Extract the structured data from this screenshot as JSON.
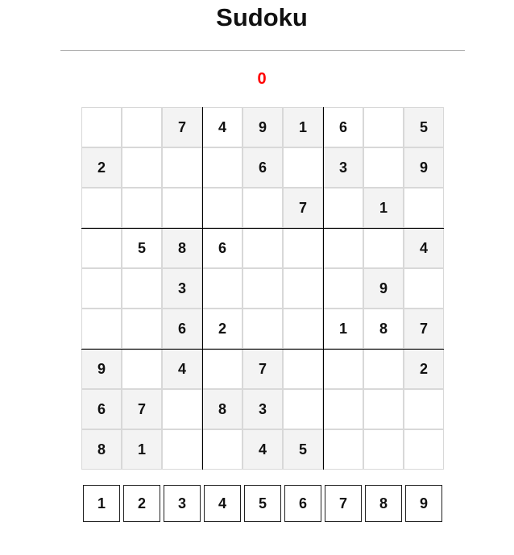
{
  "title": "Sudoku",
  "score": "0",
  "colors": {
    "score": "#ff0000",
    "given_cell_bg": "#f3f3f3",
    "empty_cell_bg": "#ffffff",
    "cell_border": "#d8d8d8",
    "box_border": "#000000"
  },
  "grid": [
    [
      "",
      "",
      "7",
      "4",
      "9",
      "1",
      "6",
      "",
      "5"
    ],
    [
      "2",
      "",
      "",
      "",
      "6",
      "",
      "3",
      "",
      "9"
    ],
    [
      "",
      "",
      "",
      "",
      "",
      "7",
      "",
      "1",
      ""
    ],
    [
      "",
      "5",
      "8",
      "6",
      "",
      "",
      "",
      "",
      "4"
    ],
    [
      "",
      "",
      "3",
      "",
      "",
      "",
      "",
      "9",
      ""
    ],
    [
      "",
      "",
      "6",
      "2",
      "",
      "",
      "1",
      "8",
      "7"
    ],
    [
      "9",
      "",
      "4",
      "",
      "7",
      "",
      "",
      "",
      "2"
    ],
    [
      "6",
      "7",
      "",
      "8",
      "3",
      "",
      "",
      "",
      ""
    ],
    [
      "8",
      "1",
      "",
      "",
      "4",
      "5",
      "",
      "",
      ""
    ]
  ],
  "shaded": [
    [
      0,
      0,
      1,
      0,
      1,
      1,
      0,
      0,
      1
    ],
    [
      1,
      0,
      0,
      0,
      1,
      0,
      1,
      0,
      1
    ],
    [
      0,
      0,
      0,
      0,
      0,
      1,
      0,
      1,
      0
    ],
    [
      0,
      0,
      1,
      0,
      0,
      0,
      0,
      0,
      1
    ],
    [
      0,
      0,
      1,
      0,
      0,
      0,
      0,
      1,
      0
    ],
    [
      0,
      0,
      1,
      0,
      0,
      0,
      0,
      0,
      1
    ],
    [
      1,
      0,
      1,
      0,
      1,
      0,
      0,
      0,
      1
    ],
    [
      1,
      1,
      0,
      1,
      1,
      0,
      0,
      0,
      0
    ],
    [
      1,
      1,
      0,
      0,
      1,
      1,
      0,
      0,
      0
    ]
  ],
  "numpad": [
    "1",
    "2",
    "3",
    "4",
    "5",
    "6",
    "7",
    "8",
    "9"
  ]
}
